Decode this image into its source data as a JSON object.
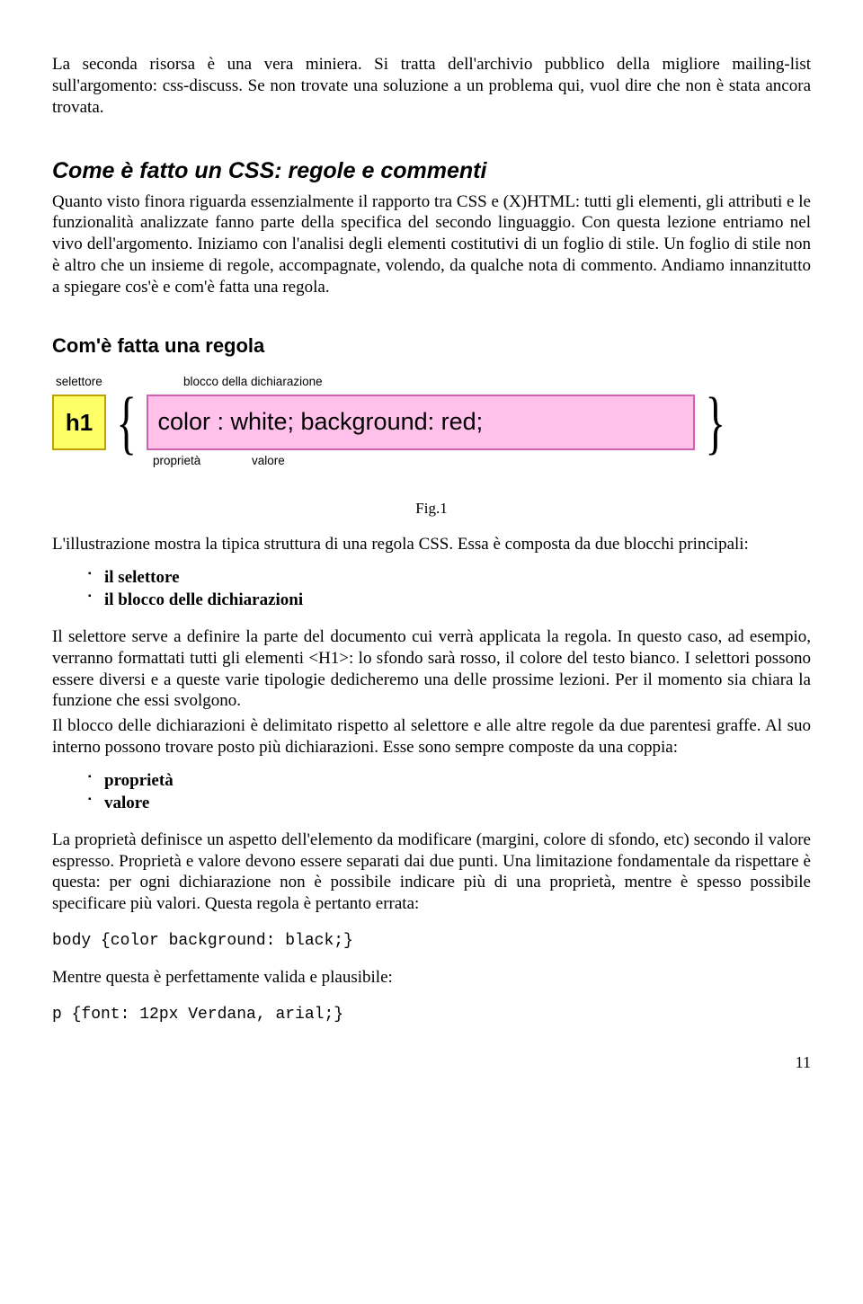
{
  "intro_para": "La seconda risorsa è una vera miniera. Si tratta dell'archivio pubblico della migliore mailing-list sull'argomento: css-discuss. Se non trovate una soluzione a un problema qui, vuol dire che non è stata ancora trovata.",
  "section1_title": "Come è fatto un CSS: regole e commenti",
  "section1_body": "Quanto visto finora riguarda essenzialmente il rapporto tra CSS e (X)HTML: tutti gli elementi, gli attributi e le funzionalità analizzate fanno parte della specifica del secondo linguaggio. Con questa lezione entriamo nel vivo dell'argomento. Iniziamo con l'analisi degli elementi costitutivi di un foglio di stile. Un foglio di stile non è altro che un insieme di regole, accompagnate, volendo, da qualche nota di commento. Andiamo innanzitutto a spiegare cos'è e com'è fatta una regola.",
  "section2_title": "Com'è fatta una regola",
  "diagram": {
    "label_selettore": "selettore",
    "label_blocco": "blocco della dichiarazione",
    "selector_text": "h1",
    "declaration_text": "color : white; background: red;",
    "label_proprieta": "proprietà",
    "label_valore": "valore"
  },
  "fig_caption": "Fig.1",
  "para_after_fig": "L'illustrazione mostra la tipica struttura di una regola CSS. Essa è composta da due blocchi principali:",
  "list1": {
    "item1": "il selettore",
    "item2": "il blocco delle dichiarazioni"
  },
  "para_selettore": "Il selettore serve a definire la parte del documento cui verrà applicata la regola. In questo caso, ad esempio, verranno formattati tutti gli elementi <H1>: lo sfondo sarà rosso, il colore del testo bianco. I selettori possono essere diversi e a queste varie tipologie dedicheremo una delle prossime lezioni. Per il momento sia chiara la funzione che essi svolgono.",
  "para_blocco": "Il blocco delle dichiarazioni è delimitato rispetto al selettore e alle altre regole da due parentesi graffe. Al suo interno possono trovare posto più dichiarazioni. Esse sono sempre composte da una coppia:",
  "list2": {
    "item1": "proprietà",
    "item2": "valore"
  },
  "para_proprieta": "La proprietà definisce un aspetto dell'elemento da modificare (margini, colore di sfondo, etc) secondo il valore espresso. Proprietà e valore devono essere separati dai due punti. Una limitazione fondamentale da rispettare è questa: per ogni dichiarazione non è possibile indicare più di una proprietà, mentre è spesso possibile specificare più valori. Questa regola è pertanto errata:",
  "code1": "body {color background: black;}",
  "para_valid": "Mentre questa è perfettamente valida e plausibile:",
  "code2": "p {font: 12px Verdana, arial;}",
  "page_number": "11"
}
